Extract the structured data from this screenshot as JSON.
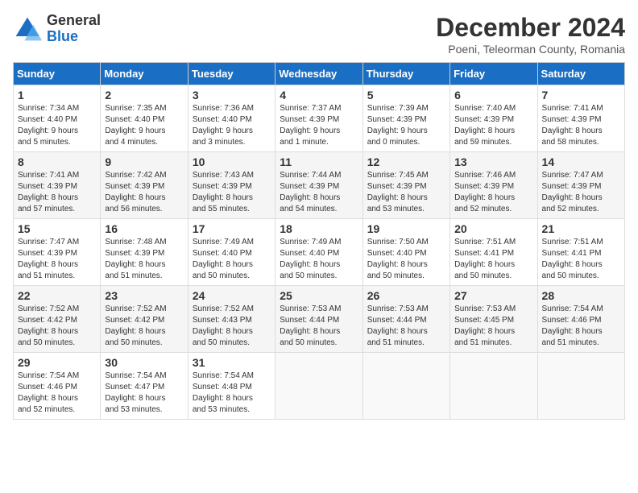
{
  "header": {
    "logo_general": "General",
    "logo_blue": "Blue",
    "title": "December 2024",
    "subtitle": "Poeni, Teleorman County, Romania"
  },
  "columns": [
    "Sunday",
    "Monday",
    "Tuesday",
    "Wednesday",
    "Thursday",
    "Friday",
    "Saturday"
  ],
  "weeks": [
    [
      {
        "day": "1",
        "info": "Sunrise: 7:34 AM\nSunset: 4:40 PM\nDaylight: 9 hours\nand 5 minutes."
      },
      {
        "day": "2",
        "info": "Sunrise: 7:35 AM\nSunset: 4:40 PM\nDaylight: 9 hours\nand 4 minutes."
      },
      {
        "day": "3",
        "info": "Sunrise: 7:36 AM\nSunset: 4:40 PM\nDaylight: 9 hours\nand 3 minutes."
      },
      {
        "day": "4",
        "info": "Sunrise: 7:37 AM\nSunset: 4:39 PM\nDaylight: 9 hours\nand 1 minute."
      },
      {
        "day": "5",
        "info": "Sunrise: 7:39 AM\nSunset: 4:39 PM\nDaylight: 9 hours\nand 0 minutes."
      },
      {
        "day": "6",
        "info": "Sunrise: 7:40 AM\nSunset: 4:39 PM\nDaylight: 8 hours\nand 59 minutes."
      },
      {
        "day": "7",
        "info": "Sunrise: 7:41 AM\nSunset: 4:39 PM\nDaylight: 8 hours\nand 58 minutes."
      }
    ],
    [
      {
        "day": "8",
        "info": "Sunrise: 7:41 AM\nSunset: 4:39 PM\nDaylight: 8 hours\nand 57 minutes."
      },
      {
        "day": "9",
        "info": "Sunrise: 7:42 AM\nSunset: 4:39 PM\nDaylight: 8 hours\nand 56 minutes."
      },
      {
        "day": "10",
        "info": "Sunrise: 7:43 AM\nSunset: 4:39 PM\nDaylight: 8 hours\nand 55 minutes."
      },
      {
        "day": "11",
        "info": "Sunrise: 7:44 AM\nSunset: 4:39 PM\nDaylight: 8 hours\nand 54 minutes."
      },
      {
        "day": "12",
        "info": "Sunrise: 7:45 AM\nSunset: 4:39 PM\nDaylight: 8 hours\nand 53 minutes."
      },
      {
        "day": "13",
        "info": "Sunrise: 7:46 AM\nSunset: 4:39 PM\nDaylight: 8 hours\nand 52 minutes."
      },
      {
        "day": "14",
        "info": "Sunrise: 7:47 AM\nSunset: 4:39 PM\nDaylight: 8 hours\nand 52 minutes."
      }
    ],
    [
      {
        "day": "15",
        "info": "Sunrise: 7:47 AM\nSunset: 4:39 PM\nDaylight: 8 hours\nand 51 minutes."
      },
      {
        "day": "16",
        "info": "Sunrise: 7:48 AM\nSunset: 4:39 PM\nDaylight: 8 hours\nand 51 minutes."
      },
      {
        "day": "17",
        "info": "Sunrise: 7:49 AM\nSunset: 4:40 PM\nDaylight: 8 hours\nand 50 minutes."
      },
      {
        "day": "18",
        "info": "Sunrise: 7:49 AM\nSunset: 4:40 PM\nDaylight: 8 hours\nand 50 minutes."
      },
      {
        "day": "19",
        "info": "Sunrise: 7:50 AM\nSunset: 4:40 PM\nDaylight: 8 hours\nand 50 minutes."
      },
      {
        "day": "20",
        "info": "Sunrise: 7:51 AM\nSunset: 4:41 PM\nDaylight: 8 hours\nand 50 minutes."
      },
      {
        "day": "21",
        "info": "Sunrise: 7:51 AM\nSunset: 4:41 PM\nDaylight: 8 hours\nand 50 minutes."
      }
    ],
    [
      {
        "day": "22",
        "info": "Sunrise: 7:52 AM\nSunset: 4:42 PM\nDaylight: 8 hours\nand 50 minutes."
      },
      {
        "day": "23",
        "info": "Sunrise: 7:52 AM\nSunset: 4:42 PM\nDaylight: 8 hours\nand 50 minutes."
      },
      {
        "day": "24",
        "info": "Sunrise: 7:52 AM\nSunset: 4:43 PM\nDaylight: 8 hours\nand 50 minutes."
      },
      {
        "day": "25",
        "info": "Sunrise: 7:53 AM\nSunset: 4:44 PM\nDaylight: 8 hours\nand 50 minutes."
      },
      {
        "day": "26",
        "info": "Sunrise: 7:53 AM\nSunset: 4:44 PM\nDaylight: 8 hours\nand 51 minutes."
      },
      {
        "day": "27",
        "info": "Sunrise: 7:53 AM\nSunset: 4:45 PM\nDaylight: 8 hours\nand 51 minutes."
      },
      {
        "day": "28",
        "info": "Sunrise: 7:54 AM\nSunset: 4:46 PM\nDaylight: 8 hours\nand 51 minutes."
      }
    ],
    [
      {
        "day": "29",
        "info": "Sunrise: 7:54 AM\nSunset: 4:46 PM\nDaylight: 8 hours\nand 52 minutes."
      },
      {
        "day": "30",
        "info": "Sunrise: 7:54 AM\nSunset: 4:47 PM\nDaylight: 8 hours\nand 53 minutes."
      },
      {
        "day": "31",
        "info": "Sunrise: 7:54 AM\nSunset: 4:48 PM\nDaylight: 8 hours\nand 53 minutes."
      },
      null,
      null,
      null,
      null
    ]
  ]
}
